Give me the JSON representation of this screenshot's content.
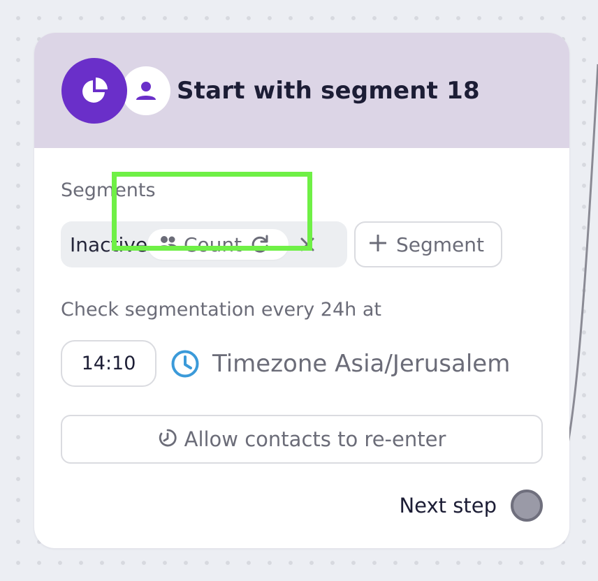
{
  "node": {
    "title": "Start with segment 18",
    "segments_label": "Segments",
    "segment": {
      "name": "Inactive",
      "count_label": "Count",
      "remove_symbol": "×"
    },
    "add_segment_label": "Segment",
    "check_label": "Check segmentation every 24h at",
    "time_value": "14:10",
    "timezone_label": "Timezone Asia/Jerusalem",
    "reenter_label": "Allow contacts to re-enter",
    "next_step_label": "Next step"
  },
  "colors": {
    "accent": "#6a2fc9",
    "header_bg": "#dcd5e6",
    "clock_blue": "#3b9ad9",
    "highlight": "#6ff046"
  },
  "icons": [
    "pie-chart-icon",
    "person-icon",
    "people-icon",
    "refresh-icon",
    "close-icon",
    "plus-icon",
    "clock-icon",
    "timer-icon"
  ]
}
